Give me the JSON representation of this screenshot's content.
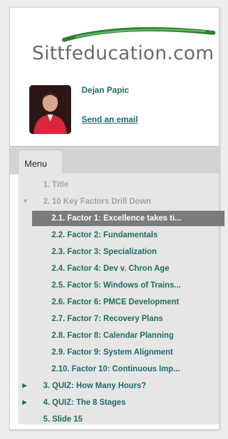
{
  "logo": {
    "text": "Sittfeducation.com"
  },
  "presenter": {
    "name": "Dejan Papic",
    "email_link": "Send an email"
  },
  "menu": {
    "tab_label": "Menu",
    "items": [
      {
        "label": "1. Title"
      },
      {
        "label": "2. 10 Key Factors Drill Down"
      },
      {
        "label": "2.1. Factor 1: Excellence takes ti..."
      },
      {
        "label": "2.2. Factor 2: Fundamentals"
      },
      {
        "label": "2.3. Factor 3: Specialization"
      },
      {
        "label": "2.4. Factor 4: Dev v. Chron Age"
      },
      {
        "label": "2.5. Factor 5: Windows of Trains..."
      },
      {
        "label": "2.6. Factor 6: PMCE Development"
      },
      {
        "label": "2.7. Factor 7: Recovery Plans"
      },
      {
        "label": "2.8. Factor 8: Calendar Planning"
      },
      {
        "label": "2.9. Factor 9: System Alignment"
      },
      {
        "label": "2.10. Factor 10: Continuous Imp..."
      },
      {
        "label": "3. QUIZ: How Many Hours?"
      },
      {
        "label": "4. QUIZ: The 8 Stages"
      },
      {
        "label": "5. Slide 15"
      }
    ]
  },
  "colors": {
    "accent": "#1f6b66",
    "selected_bg": "#7b7b7b",
    "dimmed_text": "#a3a3a3",
    "logo_swoosh": "#2e7d32"
  },
  "icons": {
    "expanded": "triangle-down-icon",
    "collapsed": "triangle-right-icon"
  }
}
